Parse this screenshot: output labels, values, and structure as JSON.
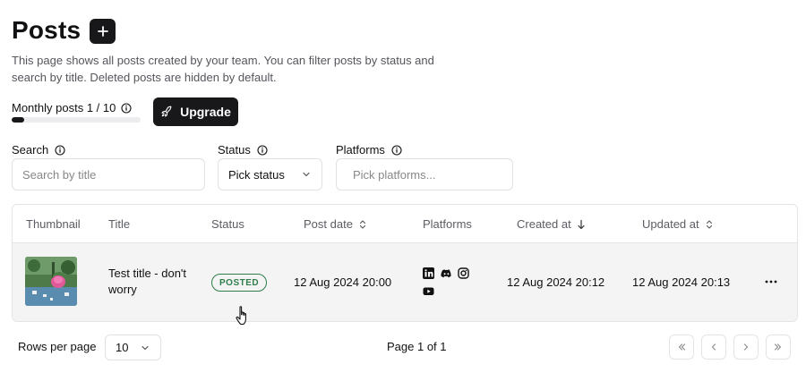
{
  "page": {
    "title": "Posts",
    "description": "This page shows all posts created by your team. You can filter posts by status and search by title. Deleted posts are hidden by default."
  },
  "quota": {
    "label": "Monthly posts 1 / 10",
    "used": 1,
    "limit": 10,
    "fraction": 0.1,
    "upgrade_label": "Upgrade"
  },
  "filters": {
    "search_label": "Search",
    "search_placeholder": "Search by title",
    "status_label": "Status",
    "status_value": "Pick status",
    "platforms_label": "Platforms",
    "platforms_placeholder": "Pick platforms..."
  },
  "table": {
    "columns": [
      "Thumbnail",
      "Title",
      "Status",
      "Post date",
      "Platforms",
      "Created at",
      "Updated at"
    ],
    "rows": [
      {
        "title": "Test title - don't worry",
        "status": "POSTED",
        "post_date": "12 Aug 2024 20:00",
        "platforms": [
          "linkedin-icon",
          "discord-icon",
          "instagram-icon",
          "youtube-icon"
        ],
        "created_at": "12 Aug 2024 20:12",
        "updated_at": "12 Aug 2024 20:13"
      }
    ]
  },
  "pagination": {
    "rows_per_page_label": "Rows per page",
    "rows_per_page_value": "10",
    "page_info": "Page 1 of 1"
  },
  "colors": {
    "primary": "#18181b",
    "status_posted": "#2f7d4a",
    "row_bg": "#f4f4f5"
  }
}
